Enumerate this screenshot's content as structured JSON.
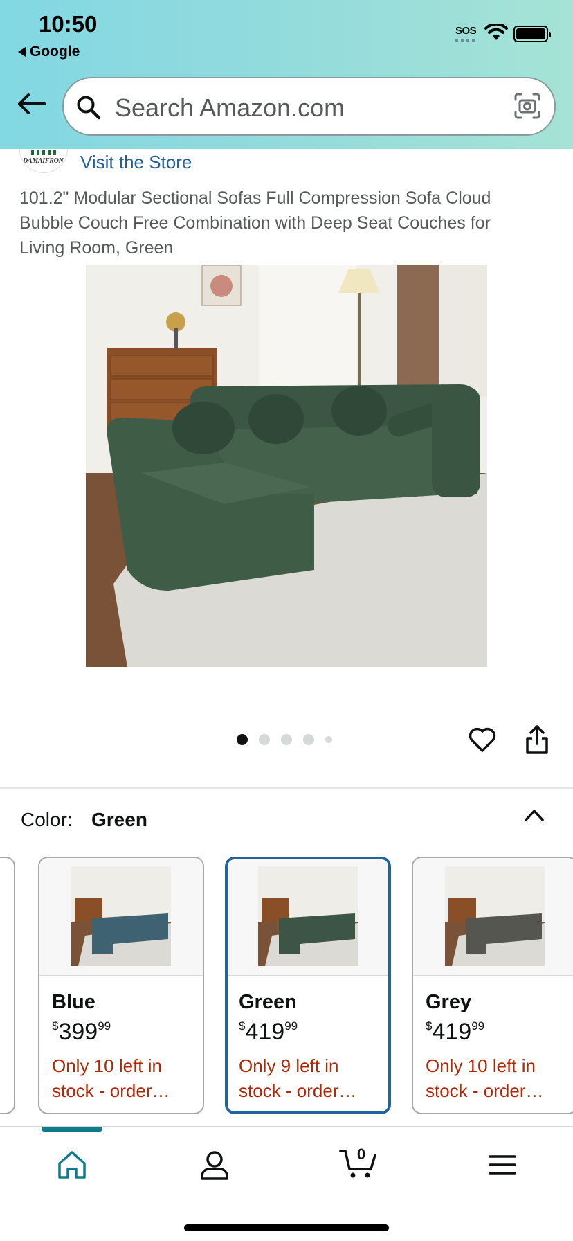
{
  "status_bar": {
    "time": "10:50",
    "back_app": "Google",
    "sos": "SOS"
  },
  "search": {
    "placeholder": "Search Amazon.com"
  },
  "product": {
    "brand_logo_text": "DAMAIFRON",
    "visit_store": "Visit the Store",
    "title": "101.2\" Modular Sectional Sofas Full Compression Sofa Cloud Bubble Couch Free Combination with Deep Seat Couches for Living Room, Green",
    "image_count": 5,
    "active_image_index": 0
  },
  "color_selector": {
    "label": "Color:",
    "selected": "Green",
    "options": [
      {
        "name": "Blue",
        "currency": "$",
        "price_whole": "399",
        "price_fraction": "99",
        "stock": "Only 10 left in stock - order…",
        "sofa_color": "#3f6272"
      },
      {
        "name": "Green",
        "currency": "$",
        "price_whole": "419",
        "price_fraction": "99",
        "stock": "Only 9 left in stock - order…",
        "sofa_color": "#3d5545"
      },
      {
        "name": "Grey",
        "currency": "$",
        "price_whole": "419",
        "price_fraction": "99",
        "stock": "Only 10 left in stock - order…",
        "sofa_color": "#55564f"
      }
    ]
  },
  "bottom_nav": {
    "items": [
      "home-icon",
      "account-icon",
      "cart-icon",
      "menu-icon"
    ],
    "cart_count": "0",
    "active_color": "#0f7c8c"
  },
  "colors": {
    "link": "#1f5f9d",
    "stock_red": "#b12704",
    "selected_border": "#2162a1"
  }
}
